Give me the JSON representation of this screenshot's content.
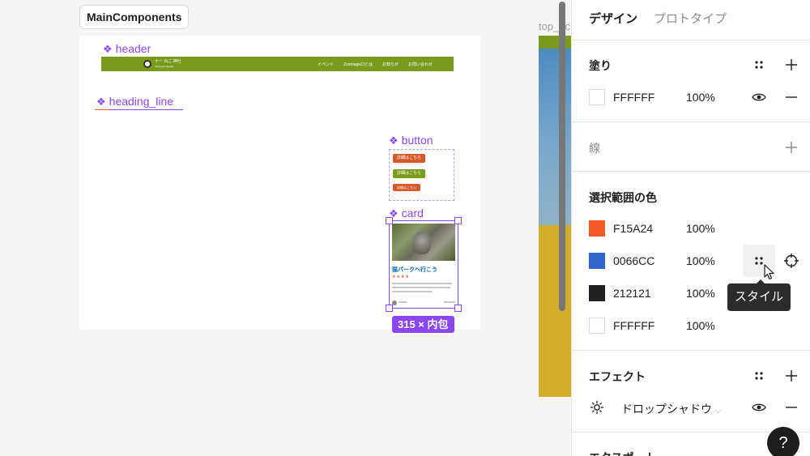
{
  "canvas": {
    "frame_label": "MainComponents",
    "components": [
      {
        "name": "header"
      },
      {
        "name": "heading_line"
      },
      {
        "name": "button"
      },
      {
        "name": "card"
      }
    ],
    "header_preview": {
      "site_name": "ナー ねこ 神社",
      "subtitle": "Find your favorite",
      "nav": [
        "イベント",
        "Zoomage口とは",
        "お知らせ",
        "お問い合わせ"
      ]
    },
    "button_preview": {
      "labels": [
        "詳細はこちら",
        "詳細はこちら",
        "詳細はこちら"
      ],
      "colors": [
        "#D5582A",
        "#7A9A1C",
        "#D5582A"
      ]
    },
    "card_preview": {
      "title": "猫パークへ行こう",
      "stars": "★★★★"
    },
    "selection_size": "315 × 内包",
    "right_frame_label": "top_pc",
    "accent_color": "#8A47F0"
  },
  "panel": {
    "tabs": {
      "design": "デザイン",
      "prototype": "プロトタイプ"
    },
    "fill": {
      "title": "塗り",
      "items": [
        {
          "hex": "FFFFFF",
          "opacity": "100%",
          "color": "#FFFFFF"
        }
      ]
    },
    "stroke": {
      "title": "線"
    },
    "selection_colors": {
      "title": "選択範囲の色",
      "items": [
        {
          "hex": "F15A24",
          "opacity": "100%",
          "color": "#F15A24"
        },
        {
          "hex": "0066CC",
          "opacity": "100%",
          "color": "#3366CC"
        },
        {
          "hex": "212121",
          "opacity": "100%",
          "color": "#212121"
        },
        {
          "hex": "FFFFFF",
          "opacity": "100%",
          "color": "#FFFFFF"
        }
      ]
    },
    "tooltip": "スタイル",
    "effects": {
      "title": "エフェクト",
      "items": [
        {
          "name": "ドロップシャドウ"
        }
      ]
    },
    "export": {
      "title": "エクスポート"
    },
    "help": "?"
  }
}
